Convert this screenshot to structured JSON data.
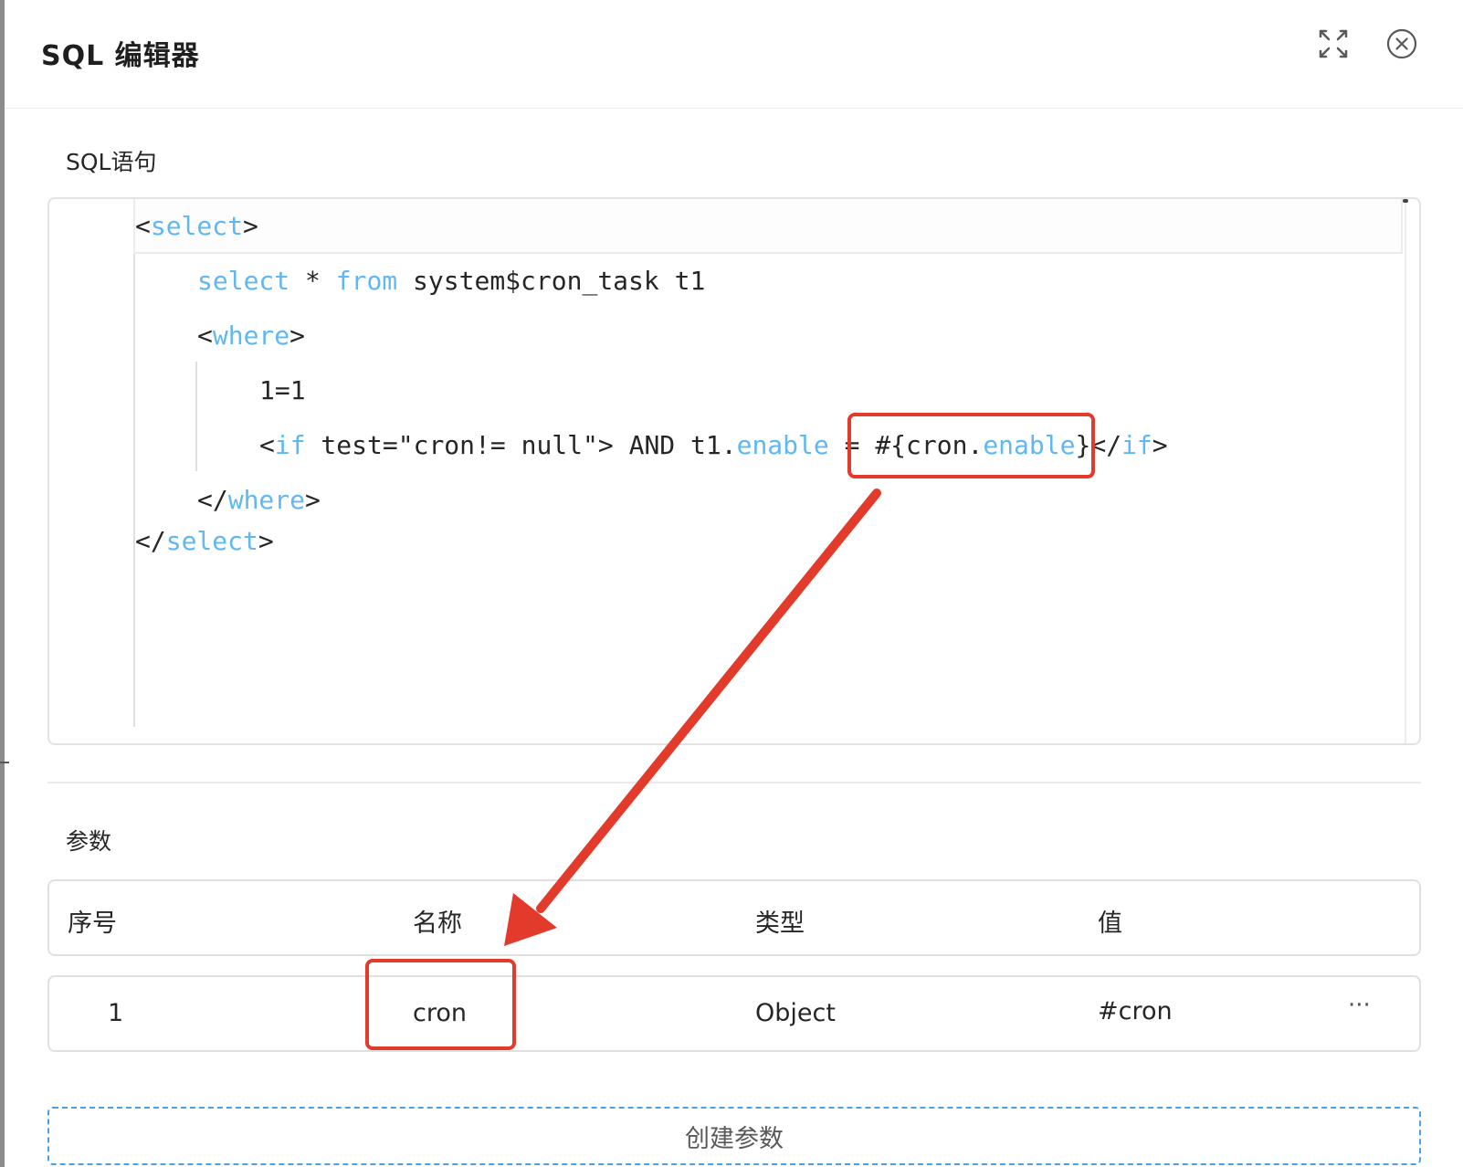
{
  "dialog": {
    "title": "SQL 编辑器",
    "expand_icon": "fullscreen-expand-icon",
    "close_icon": "close-circle-icon"
  },
  "sql_section": {
    "label": "SQL语句",
    "code": {
      "line1": {
        "p1": "<",
        "k1": "select",
        "p2": ">"
      },
      "line2": {
        "k1": "select",
        "p1": " * ",
        "k2": "from",
        "p2": " system$cron_task t1"
      },
      "line3": {
        "p1": "<",
        "k1": "where",
        "p2": ">"
      },
      "line4": {
        "p1": "1=1"
      },
      "line5": {
        "p1": "<",
        "k1": "if",
        "p2": " test=\"cron!= null\"> AND t1.",
        "k2": "enable",
        "p3": " = #{cron.",
        "k3": "enable",
        "p4": "}</",
        "k4": "if",
        "p5": ">"
      },
      "line6": {
        "p1": "</",
        "k1": "where",
        "p2": ">"
      },
      "line7": {
        "p1": "</",
        "k1": "select",
        "p2": ">"
      }
    }
  },
  "params_section": {
    "label": "参数",
    "columns": [
      "序号",
      "名称",
      "类型",
      "值"
    ],
    "rows": [
      {
        "index": "1",
        "name": "cron",
        "type": "Object",
        "value": "#cron",
        "more": "···"
      }
    ],
    "create_button": "创建参数"
  },
  "colors": {
    "keyword": "#5fb8f2",
    "annotation": "#e33b2b",
    "dashed_border": "#4a9fe6"
  }
}
